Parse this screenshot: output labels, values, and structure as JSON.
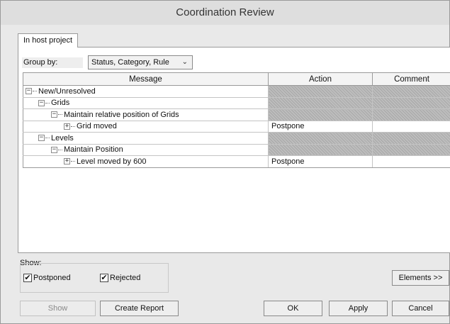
{
  "window": {
    "title": "Coordination Review"
  },
  "tabs": [
    {
      "label": "In host project"
    }
  ],
  "group_by": {
    "label": "Group by:",
    "value": "Status, Category, Rule"
  },
  "columns": {
    "message": "Message",
    "action": "Action",
    "comment": "Comment"
  },
  "rows": [
    {
      "message": "New/Unresolved",
      "level": 0,
      "toggle": "−",
      "action": "",
      "comment": "",
      "hatched": true
    },
    {
      "message": "Grids",
      "level": 1,
      "toggle": "−",
      "action": "",
      "comment": "",
      "hatched": true
    },
    {
      "message": "Maintain relative position of Grids",
      "level": 2,
      "toggle": "−",
      "action": "",
      "comment": "",
      "hatched": true
    },
    {
      "message": "Grid moved",
      "level": 3,
      "toggle": "+",
      "action": "Postpone",
      "comment": "",
      "hatched": false
    },
    {
      "message": "Levels",
      "level": 1,
      "toggle": "−",
      "action": "",
      "comment": "",
      "hatched": true
    },
    {
      "message": "Maintain Position",
      "level": 2,
      "toggle": "−",
      "action": "",
      "comment": "",
      "hatched": true
    },
    {
      "message": "Level moved by 600",
      "level": 3,
      "toggle": "+",
      "action": "Postpone",
      "comment": "",
      "hatched": false
    }
  ],
  "show": {
    "label": "Show:",
    "postponed": {
      "label": "Postponed",
      "checked": true
    },
    "rejected": {
      "label": "Rejected",
      "checked": true
    }
  },
  "buttons": {
    "elements": "Elements >>",
    "show": "Show",
    "create_report": "Create Report",
    "ok": "OK",
    "apply": "Apply",
    "cancel": "Cancel"
  },
  "check_glyph": "✔"
}
